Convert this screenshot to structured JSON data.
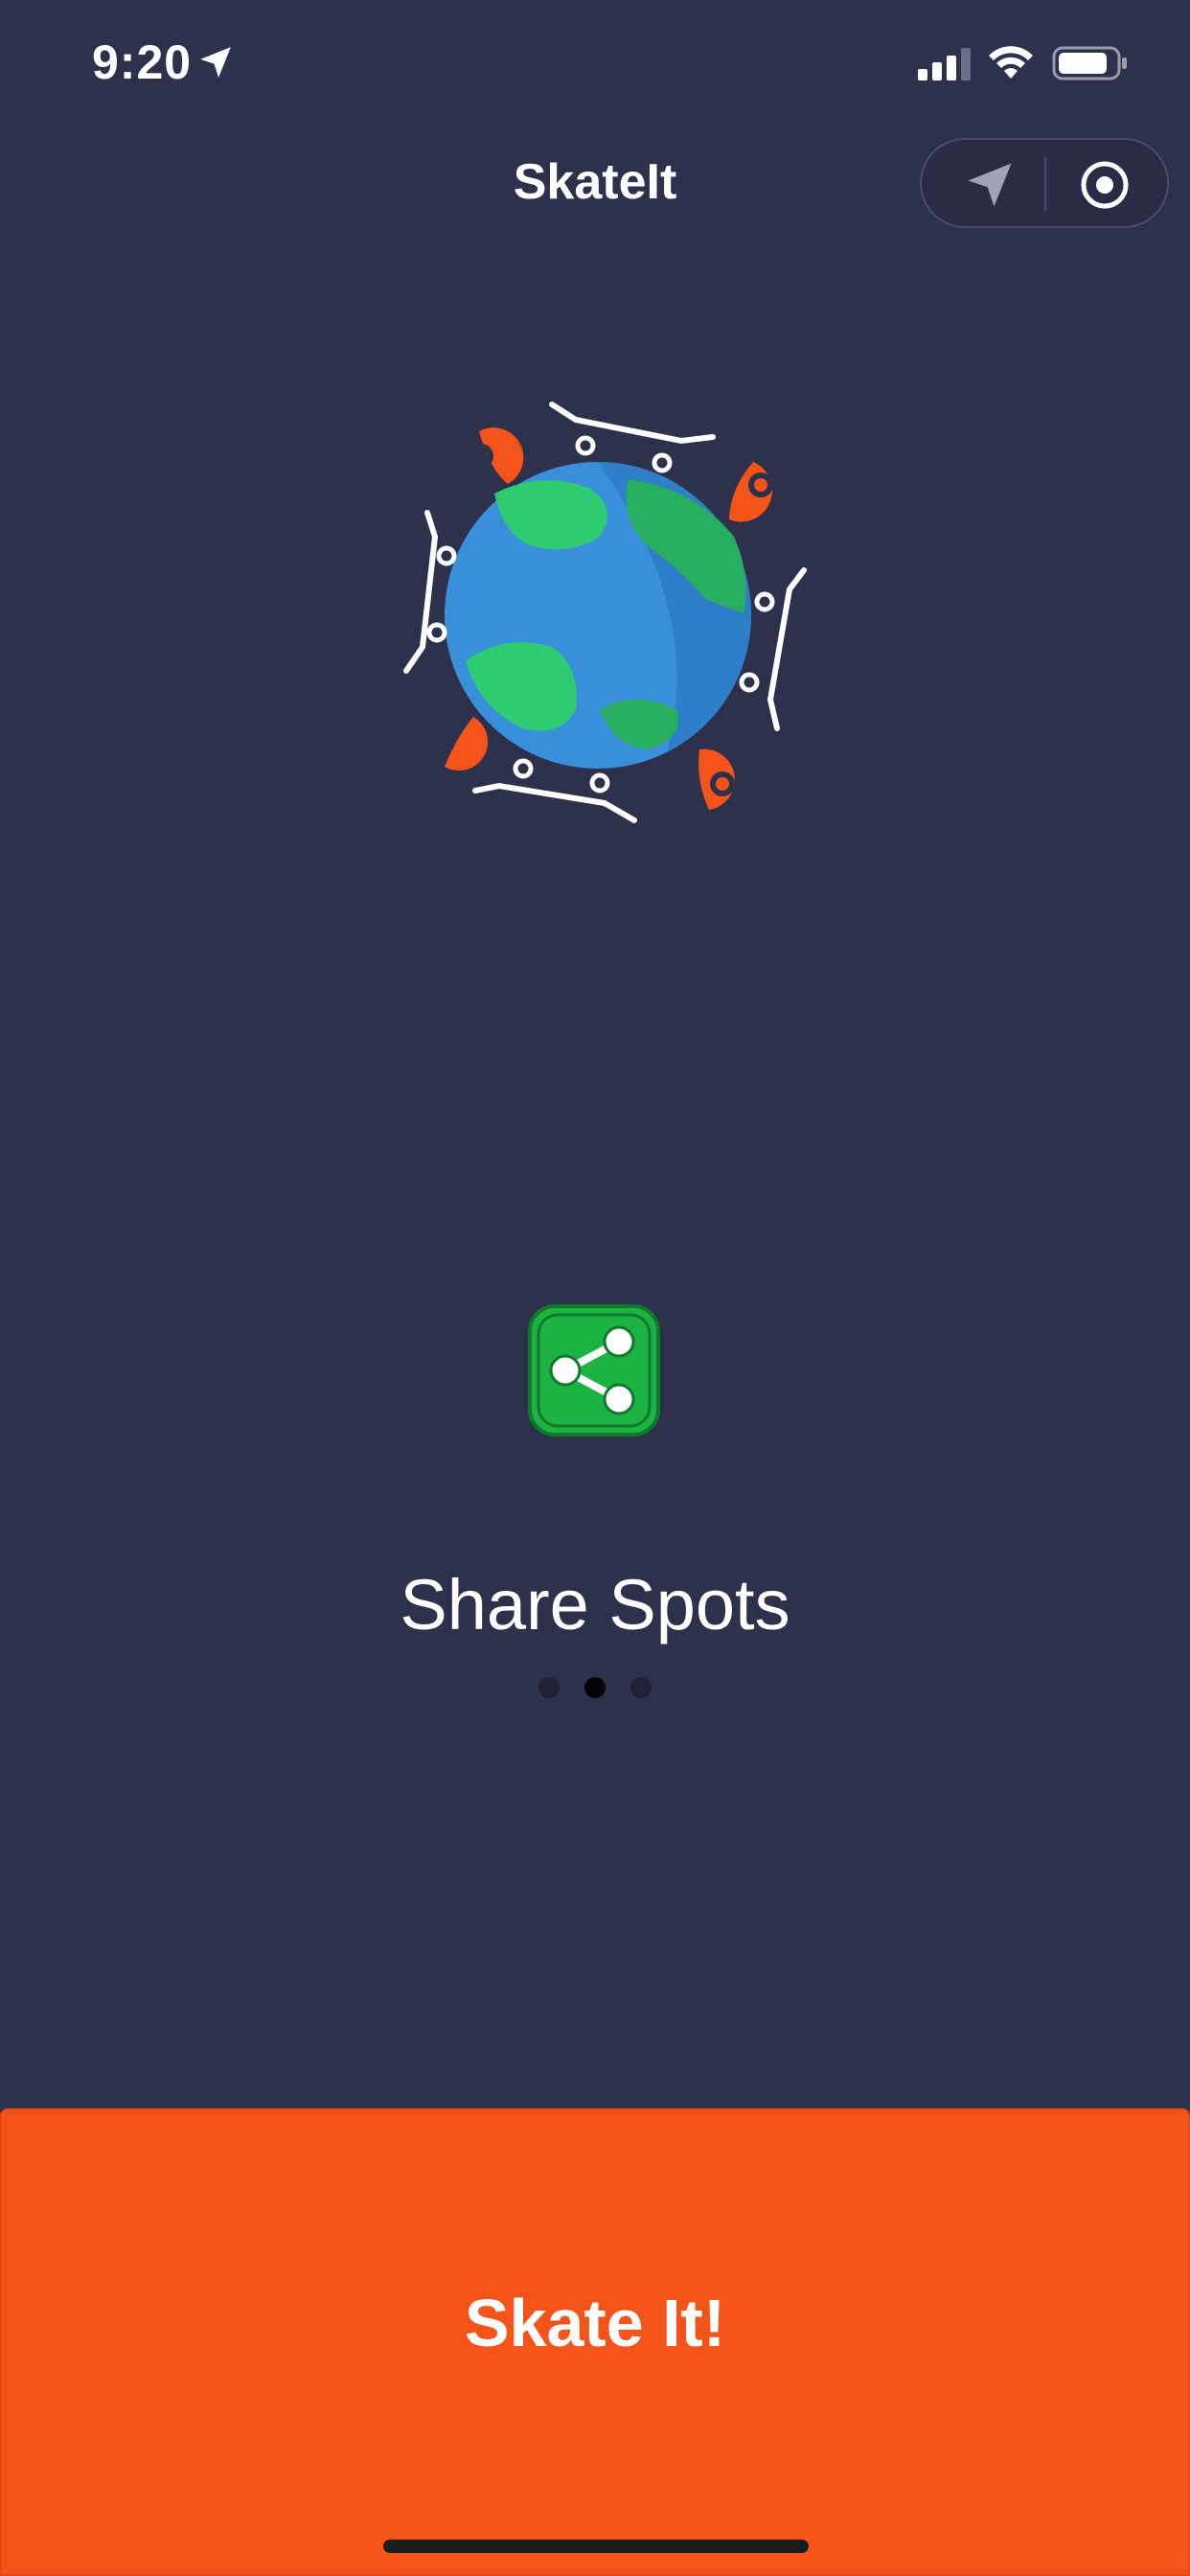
{
  "status_bar": {
    "time": "9:20",
    "icons": [
      "location-arrow-icon",
      "cellular-signal-icon",
      "wifi-icon",
      "battery-icon"
    ]
  },
  "nav": {
    "title": "SkateIt",
    "capsule_icons": [
      "navigation-arrow-icon",
      "target-circle-icon"
    ]
  },
  "illustration": {
    "name": "globe-with-skateboards-and-pins",
    "colors": {
      "ocean": "#3a8fdb",
      "land": "#2ecc71",
      "pin": "#f4541a",
      "board": "#ffffff"
    }
  },
  "feature": {
    "icon": "share-icon",
    "icon_color": "#1db344",
    "title": "Share Spots"
  },
  "pager": {
    "count": 3,
    "active_index": 1
  },
  "cta": {
    "label": "Skate It!",
    "color": "#f4541a"
  }
}
